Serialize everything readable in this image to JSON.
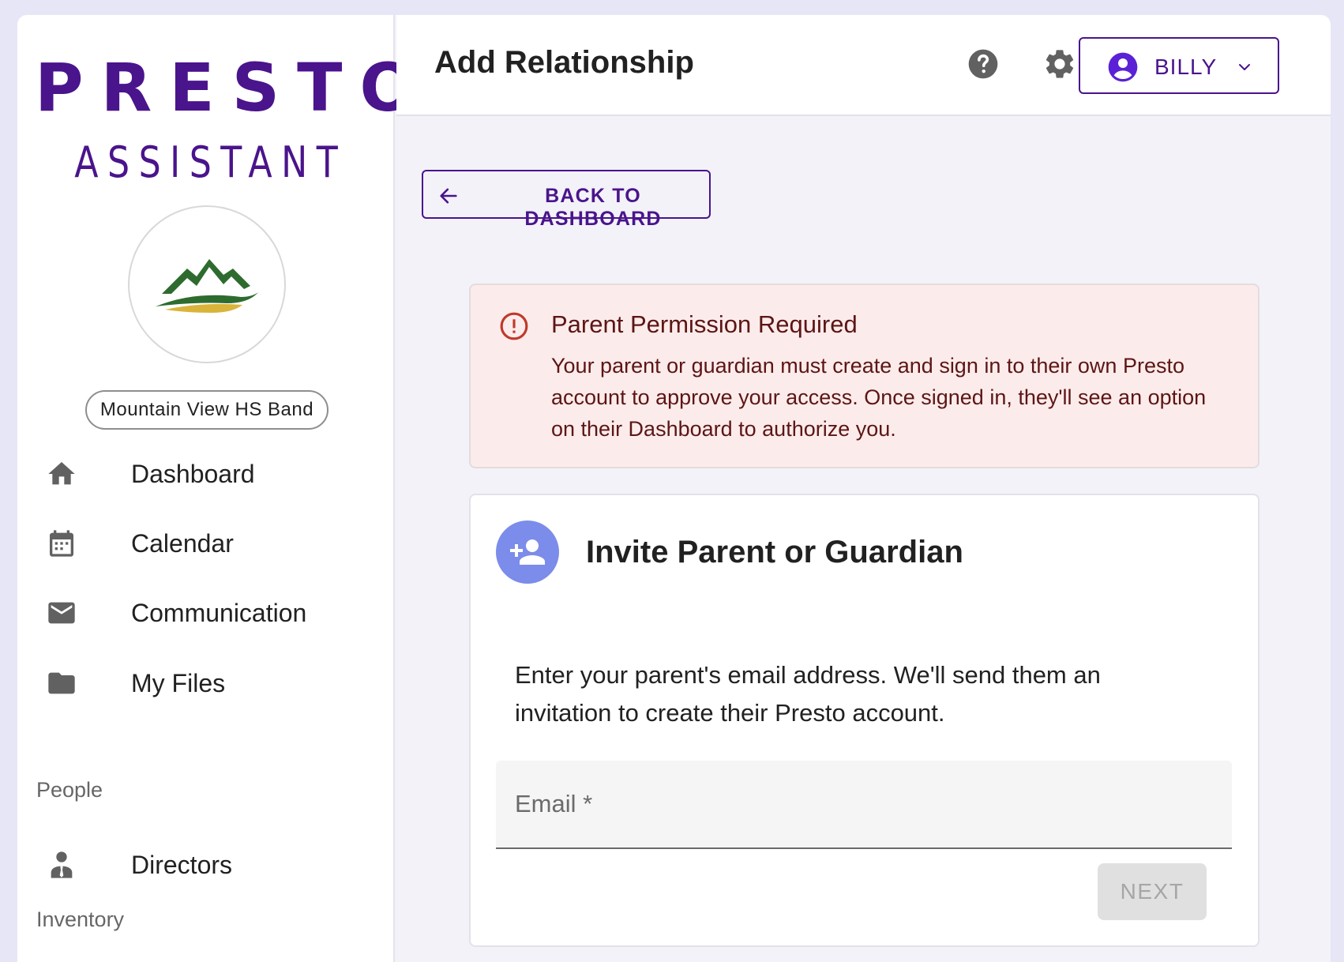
{
  "brand": {
    "logo_line1": "PRESTO",
    "logo_line2": "ASSISTANT",
    "color": "#4a148c"
  },
  "organization": {
    "name": "Mountain View HS Band",
    "logo_icon": "mountain-logo-icon"
  },
  "sidebar": {
    "items": [
      {
        "label": "Dashboard",
        "icon": "home-icon"
      },
      {
        "label": "Calendar",
        "icon": "calendar-icon"
      },
      {
        "label": "Communication",
        "icon": "mail-icon"
      },
      {
        "label": "My Files",
        "icon": "folder-icon"
      }
    ],
    "sections": [
      {
        "title": "People",
        "items": [
          {
            "label": "Directors",
            "icon": "director-icon"
          }
        ]
      },
      {
        "title": "Inventory",
        "items": []
      }
    ]
  },
  "header": {
    "title": "Add Relationship",
    "help_icon": "help-icon",
    "settings_icon": "gear-icon",
    "user_name": "BILLY"
  },
  "back_button": {
    "label": "BACK TO DASHBOARD"
  },
  "alert": {
    "title": "Parent Permission Required",
    "body": "Your parent or guardian must create and sign in to their own Presto account to approve your access. Once signed in, they'll see an option on their Dashboard to authorize you.",
    "color": "#c0392b"
  },
  "invite_card": {
    "title": "Invite Parent or Guardian",
    "description": "Enter your parent's email address. We'll send them an invitation to create their Presto account.",
    "email_placeholder": "Email *",
    "email_value": "",
    "next_label": "NEXT",
    "avatar_color": "#7b8cea"
  }
}
